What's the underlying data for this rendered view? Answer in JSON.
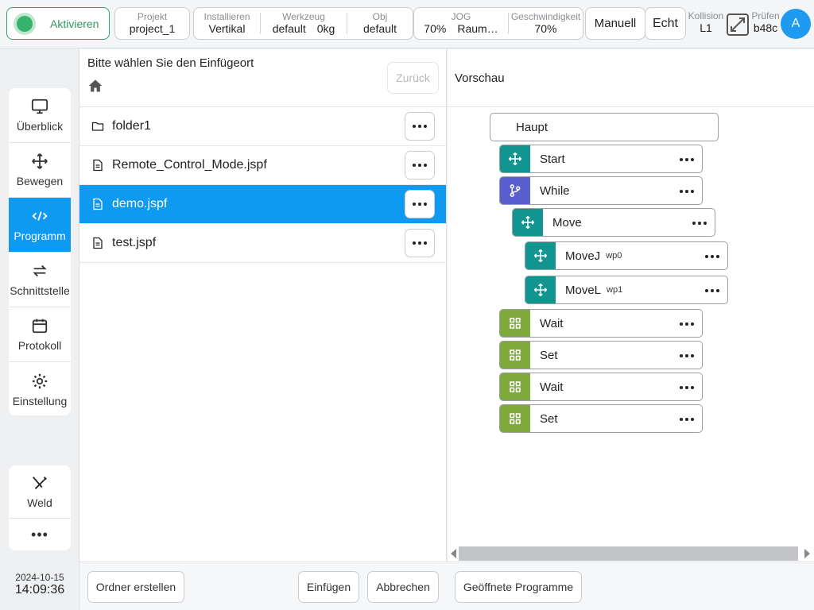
{
  "topbar": {
    "activate": "Aktivieren",
    "project": {
      "label": "Projekt",
      "value": "project_1"
    },
    "install": {
      "label": "Installieren",
      "value": "Vertikal"
    },
    "tool": {
      "label": "Werkzeug",
      "value1": "default",
      "value2": "0kg"
    },
    "obj": {
      "label": "Obj",
      "value": "default"
    },
    "jog": {
      "label": "JOG",
      "value1": "70%",
      "value2": "Raum…"
    },
    "speed": {
      "label": "Geschwindigkeit",
      "value": "70%"
    },
    "mode_button": "Manuell",
    "real_button": "Echt",
    "collision": {
      "label": "Kollision",
      "value": "L1"
    },
    "check": {
      "label": "Prüfen",
      "value": "b48c"
    },
    "avatar": "A"
  },
  "nav": {
    "items": [
      {
        "label": "Überblick",
        "icon": "monitor-icon"
      },
      {
        "label": "Bewegen",
        "icon": "move-icon"
      },
      {
        "label": "Programm",
        "icon": "code-icon"
      },
      {
        "label": "Schnittstelle",
        "icon": "swap-icon"
      },
      {
        "label": "Protokoll",
        "icon": "calendar-icon"
      },
      {
        "label": "Einstellung",
        "icon": "gear-icon"
      }
    ],
    "active_index": 2,
    "extra": {
      "label": "Weld",
      "more": "•••"
    },
    "date": "2024-10-15",
    "time": "14:09:36"
  },
  "files": {
    "title": "Bitte wählen Sie den Einfügeort",
    "back": "Zurück",
    "rows": [
      {
        "name": "folder1",
        "type": "folder"
      },
      {
        "name": "Remote_Control_Mode.jspf",
        "type": "file"
      },
      {
        "name": "demo.jspf",
        "type": "file"
      },
      {
        "name": "test.jspf",
        "type": "file"
      }
    ],
    "selected_index": 2,
    "footer": {
      "create": "Ordner erstellen",
      "insert": "Einfügen",
      "cancel": "Abbrechen"
    }
  },
  "preview": {
    "title": "Vorschau",
    "root": "Haupt",
    "nodes": [
      {
        "label": "Start",
        "sub": "",
        "color": "#12958f",
        "icon": "move-icon"
      },
      {
        "label": "While",
        "sub": "",
        "color": "#5a5fd0",
        "icon": "branch-icon"
      },
      {
        "label": "Move",
        "sub": "",
        "color": "#12958f",
        "icon": "move-icon"
      },
      {
        "label": "MoveJ",
        "sub": "wp0",
        "color": "#12958f",
        "icon": "move-icon"
      },
      {
        "label": "MoveL",
        "sub": "wp1",
        "color": "#12958f",
        "icon": "move-icon"
      },
      {
        "label": "Wait",
        "sub": "",
        "color": "#7fa93b",
        "icon": "grid-icon"
      },
      {
        "label": "Set",
        "sub": "",
        "color": "#7fa93b",
        "icon": "grid-icon"
      },
      {
        "label": "Wait",
        "sub": "",
        "color": "#7fa93b",
        "icon": "grid-icon"
      },
      {
        "label": "Set",
        "sub": "",
        "color": "#7fa93b",
        "icon": "grid-icon"
      }
    ],
    "opened_programs": "Geöffnete Programme"
  }
}
